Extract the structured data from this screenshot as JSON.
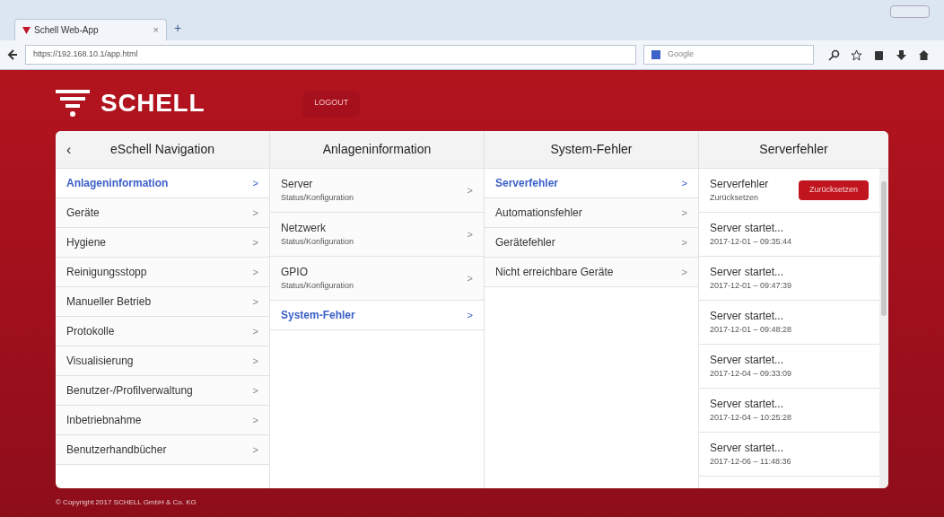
{
  "browser": {
    "tab_title": "Schell Web-App",
    "tab_close": "×",
    "new_tab": "+",
    "url": "https://192.168.10.1/app.html",
    "search_placeholder": "Google"
  },
  "header": {
    "logo_text": "SCHELL",
    "logout": "LOGOUT"
  },
  "columns": [
    {
      "title": "eSchell Navigation",
      "back": "‹",
      "items": [
        {
          "label": "Anlageninformation",
          "selected": true
        },
        {
          "label": "Geräte",
          "selected": false
        },
        {
          "label": "Hygiene",
          "selected": false
        },
        {
          "label": "Reinigungsstopp",
          "selected": false
        },
        {
          "label": "Manueller Betrieb",
          "selected": false
        },
        {
          "label": "Protokolle",
          "selected": false
        },
        {
          "label": "Visualisierung",
          "selected": false
        },
        {
          "label": "Benutzer-/Profilverwaltung",
          "selected": false
        },
        {
          "label": "Inbetriebnahme",
          "selected": false
        },
        {
          "label": "Benutzerhandbücher",
          "selected": false
        }
      ]
    },
    {
      "title": "Anlageninformation",
      "items": [
        {
          "label": "Server",
          "sub": "Status/Konfiguration",
          "selected": false
        },
        {
          "label": "Netzwerk",
          "sub": "Status/Konfiguration",
          "selected": false
        },
        {
          "label": "GPIO",
          "sub": "Status/Konfiguration",
          "selected": false
        },
        {
          "label": "System-Fehler",
          "selected": true
        }
      ]
    },
    {
      "title": "System-Fehler",
      "items": [
        {
          "label": "Serverfehler",
          "selected": true
        },
        {
          "label": "Automationsfehler",
          "selected": false
        },
        {
          "label": "Gerätefehler",
          "selected": false
        },
        {
          "label": "Nicht erreichbare Geräte",
          "selected": false
        }
      ]
    }
  ],
  "arrow": ">",
  "errors": {
    "title": "Serverfehler",
    "reset_row": {
      "label": "Serverfehler",
      "sub": "Zurücksetzen",
      "button": "Zurücksetzen"
    },
    "entries": [
      {
        "label": "Server startet...",
        "time": "2017-12-01 – 09:35:44"
      },
      {
        "label": "Server startet...",
        "time": "2017-12-01 – 09:47:39"
      },
      {
        "label": "Server startet...",
        "time": "2017-12-01 – 09:48:28"
      },
      {
        "label": "Server startet...",
        "time": "2017-12-04 – 09:33:09"
      },
      {
        "label": "Server startet...",
        "time": "2017-12-04 – 10:25:28"
      },
      {
        "label": "Server startet...",
        "time": "2017-12-06 – 11:48:36"
      }
    ]
  },
  "footer": "© Copyright 2017 SCHELL GmbH & Co. KG"
}
